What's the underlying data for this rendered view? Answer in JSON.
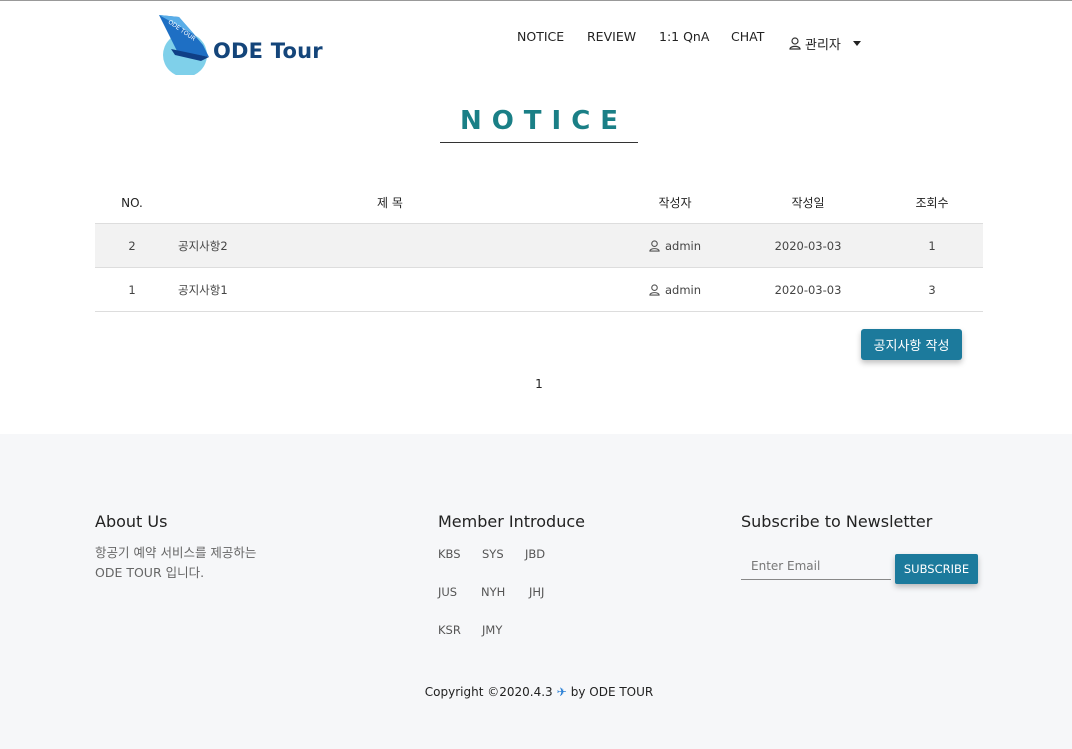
{
  "brand": {
    "name": "ODE Tour",
    "logo_text": "ODE TOUR"
  },
  "nav": {
    "items": [
      "NOTICE",
      "REVIEW",
      "1:1 QnA",
      "CHAT"
    ],
    "user_label": "관리자"
  },
  "page": {
    "title": "NOTICE"
  },
  "table": {
    "headers": {
      "no": "NO.",
      "title": "제 목",
      "writer": "작성자",
      "date": "작성일",
      "views": "조회수"
    },
    "rows": [
      {
        "no": "2",
        "title": "공지사항2",
        "writer": "admin",
        "date": "2020-03-03",
        "views": "1"
      },
      {
        "no": "1",
        "title": "공지사항1",
        "writer": "admin",
        "date": "2020-03-03",
        "views": "3"
      }
    ]
  },
  "actions": {
    "write_label": "공지사항 작성"
  },
  "pagination": {
    "current": "1"
  },
  "footer": {
    "about": {
      "heading": "About Us",
      "line1": "항공기 예약 서비스를 제공하는",
      "line2": "ODE TOUR 입니다."
    },
    "members": {
      "heading": "Member Introduce",
      "names": [
        "KBS",
        "SYS",
        "JBD",
        "JUS",
        "NYH",
        "JHJ",
        "KSR",
        "JMY"
      ]
    },
    "newsletter": {
      "heading": "Subscribe to Newsletter",
      "placeholder": "Enter Email",
      "button": "SUBSCRIBE"
    },
    "copyright_left": "Copyright ©2020.4.3",
    "copyright_right": "by ODE TOUR"
  },
  "colors": {
    "accent": "#1c7a9c",
    "title": "#1a7f86",
    "brand": "#14457a"
  }
}
